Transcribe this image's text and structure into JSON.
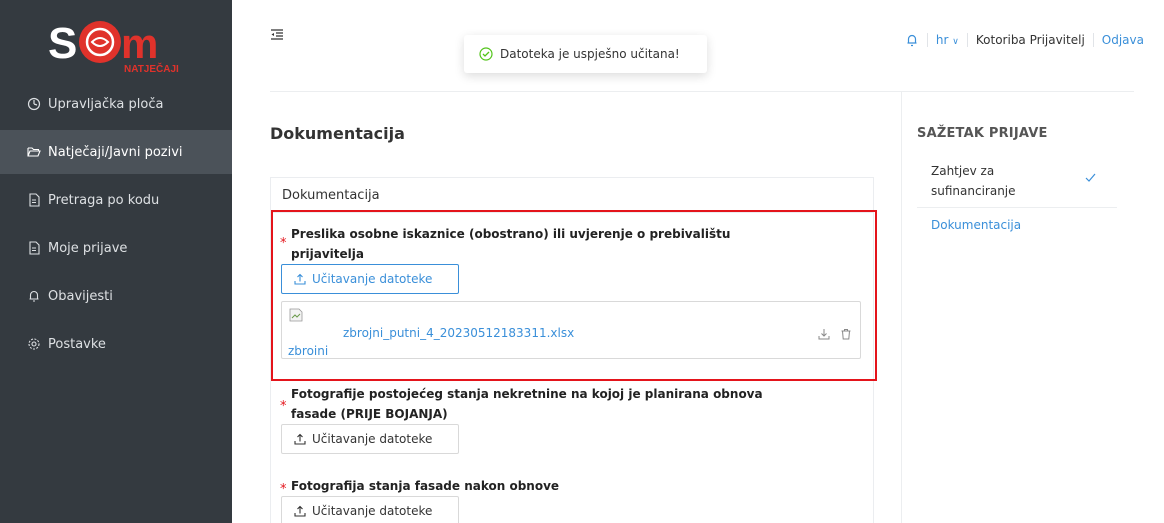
{
  "sidebar": {
    "logo_text": "NATJEČAJI",
    "items": [
      {
        "label": "Upravljačka ploča",
        "icon": "dashboard-icon"
      },
      {
        "label": "Natječaji/Javni pozivi",
        "icon": "folder-open-icon",
        "active": true
      },
      {
        "label": "Pretraga po kodu",
        "icon": "document-icon"
      },
      {
        "label": "Moje prijave",
        "icon": "document-icon"
      },
      {
        "label": "Obavijesti",
        "icon": "bell-icon"
      },
      {
        "label": "Postavke",
        "icon": "gear-icon"
      }
    ]
  },
  "toast": {
    "message": "Datoteka je uspješno učitana!"
  },
  "header": {
    "language": "hr",
    "user_name": "Kotoriba Prijavitelj",
    "logout": "Odjava"
  },
  "main": {
    "title": "Dokumentacija",
    "card_title": "Dokumentacija",
    "fields": [
      {
        "label_line1": "Preslika osobne iskaznice (obostrano) ili uvjerenje o prebivalištu",
        "label_line2": "prijavitelja",
        "upload_label": "Učitavanje datoteke",
        "file": {
          "thumb_alt": "zbroini",
          "name": "zbrojni_putni_4_20230512183311.xlsx"
        }
      },
      {
        "label_line1": "Fotografije postojećeg stanja nekretnine na kojoj je planirana obnova",
        "label_line2": "fasade (PRIJE BOJANJA)",
        "upload_label": "Učitavanje datoteke"
      },
      {
        "label_line1": "Fotografija stanja fasade nakon obnove",
        "upload_label": "Učitavanje datoteke"
      }
    ]
  },
  "summary": {
    "title": "SAŽETAK PRIJAVE",
    "items": [
      {
        "label": "Zahtjev za sufinanciranje",
        "done": true
      },
      {
        "label": "Dokumentacija",
        "done": false
      }
    ]
  },
  "colors": {
    "sidebar": "#343a40",
    "accent": "#3a8fd9",
    "highlight": "#e4141b",
    "logo_red": "#e0322b"
  }
}
